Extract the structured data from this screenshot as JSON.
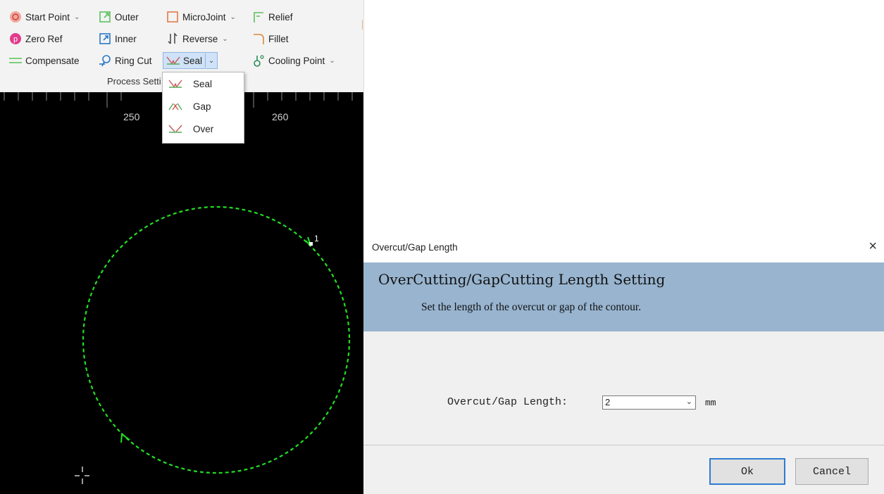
{
  "ribbon": {
    "col1": [
      {
        "label": "Start Point",
        "icon": "start-point-icon",
        "dropdown": true
      },
      {
        "label": "Zero Ref",
        "icon": "zero-ref-icon",
        "dropdown": false
      },
      {
        "label": "Compensate",
        "icon": "compensate-icon",
        "dropdown": false
      }
    ],
    "col2": [
      {
        "label": "Outer",
        "icon": "outer-icon"
      },
      {
        "label": "Inner",
        "icon": "inner-icon"
      },
      {
        "label": "Ring Cut",
        "icon": "ring-cut-icon"
      }
    ],
    "col3": [
      {
        "label": "MicroJoint",
        "icon": "microjoint-icon",
        "dropdown": true
      },
      {
        "label": "Reverse",
        "icon": "reverse-icon",
        "dropdown": true
      },
      {
        "label": "Seal",
        "icon": "seal-icon",
        "dropdown": true
      }
    ],
    "col4": [
      {
        "label": "Relief",
        "icon": "relief-icon"
      },
      {
        "label": "Fillet",
        "icon": "fillet-icon"
      },
      {
        "label": "Cooling Point",
        "icon": "cooling-point-icon",
        "dropdown": true
      }
    ],
    "group_label": "Process Setti"
  },
  "seal_menu": {
    "items": [
      {
        "label": "Seal",
        "icon": "seal-icon"
      },
      {
        "label": "Gap",
        "icon": "gap-icon"
      },
      {
        "label": "Over",
        "icon": "over-icon"
      }
    ]
  },
  "canvas": {
    "ruler_labels": [
      "250",
      "260"
    ],
    "point_label": "1",
    "colors": {
      "background": "#000000",
      "contour": "#22dd22"
    }
  },
  "dialog": {
    "title": "Overcut/Gap Length",
    "close": "×",
    "header_title": "OverCutting/GapCutting Length Setting",
    "header_desc": "Set the length of the overcut or gap of the contour.",
    "field_label": "Overcut/Gap Length:",
    "field_value": "2",
    "unit": "mm",
    "ok_label": "Ok",
    "cancel_label": "Cancel",
    "colors": {
      "header": "#98b4cf",
      "ok_border": "#2f7bd2"
    }
  }
}
